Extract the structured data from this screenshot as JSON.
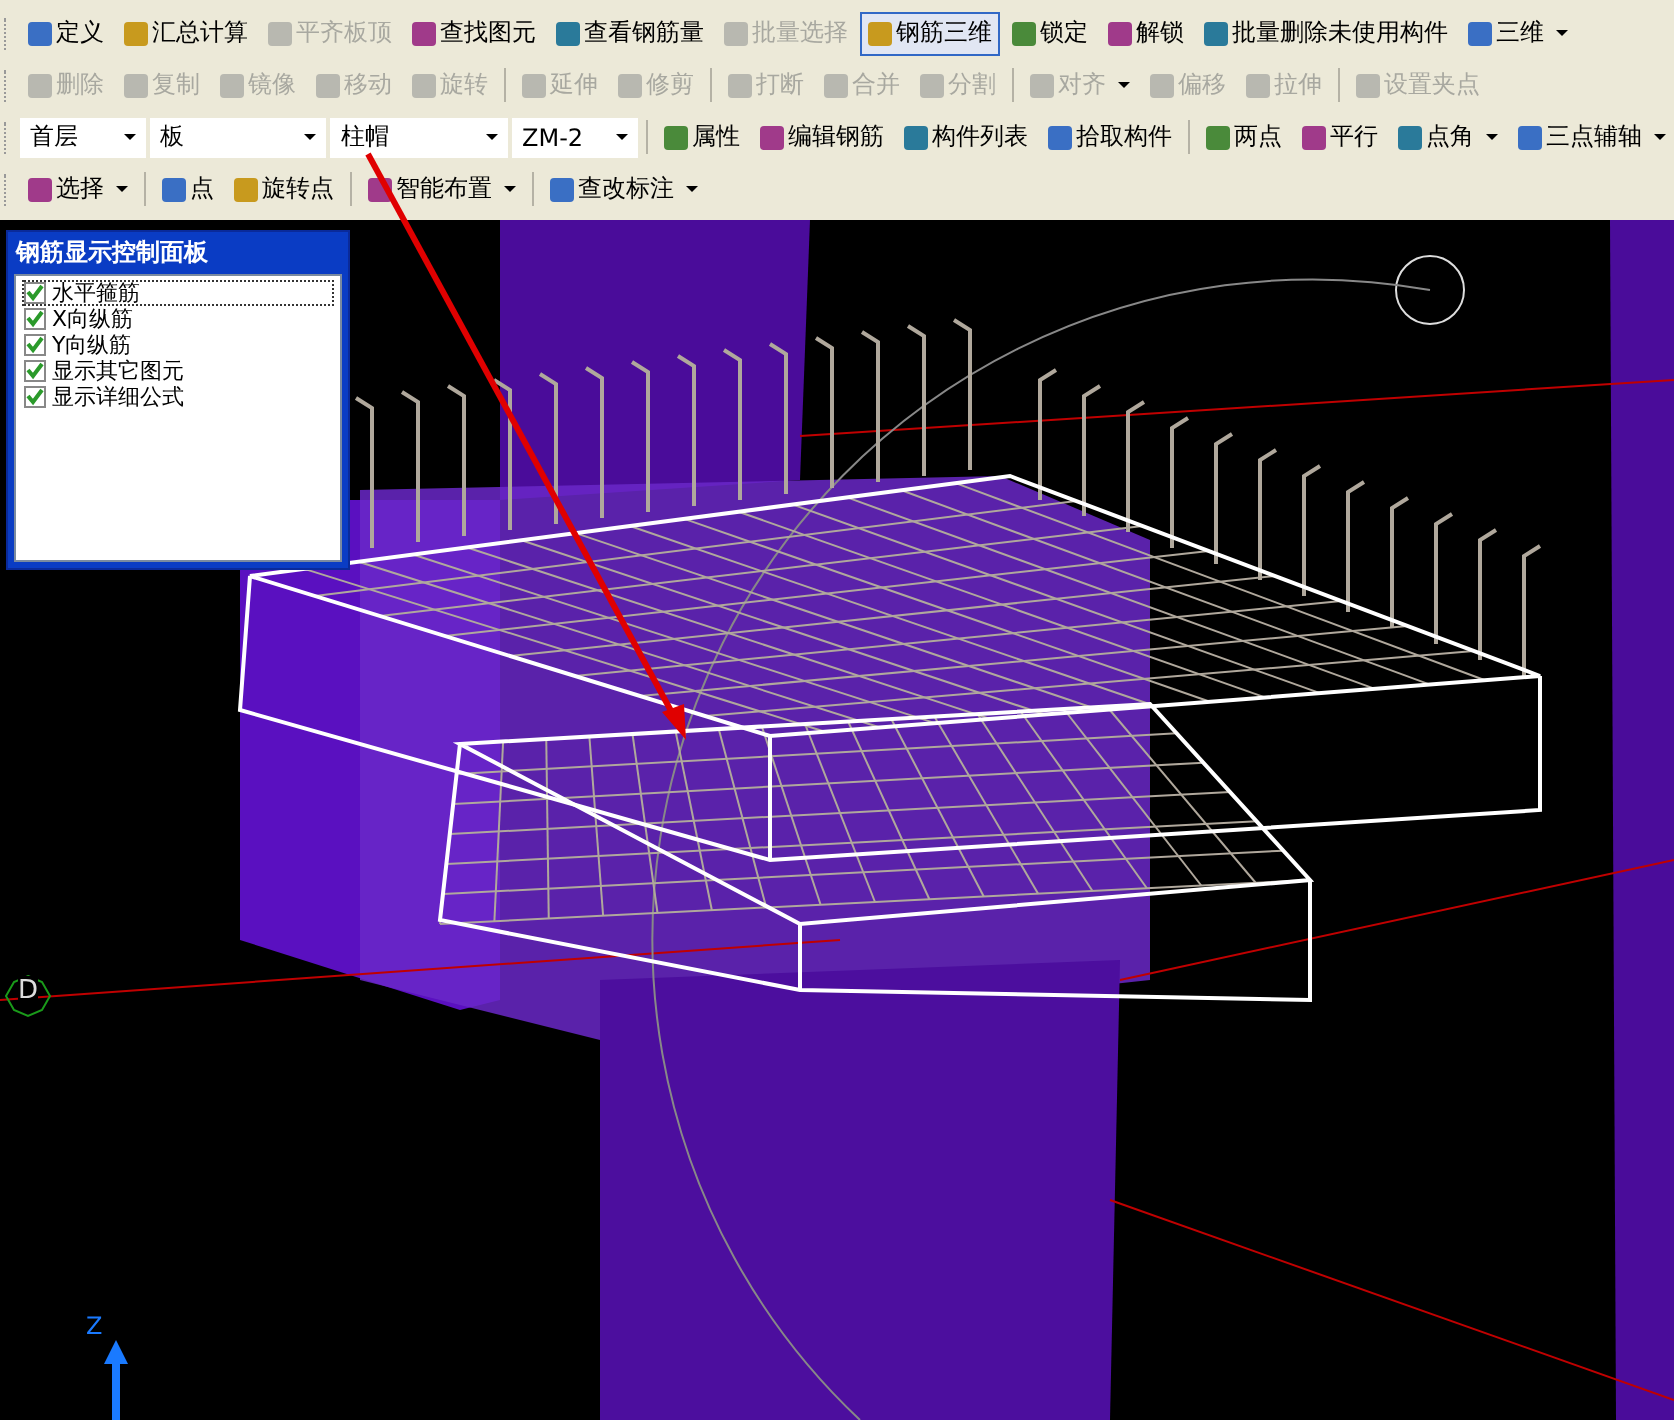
{
  "toolbars": [
    {
      "items": [
        {
          "kind": "button",
          "label": "定义",
          "disabled": false,
          "selected": false
        },
        {
          "kind": "button",
          "label": "汇总计算",
          "disabled": false,
          "selected": false
        },
        {
          "kind": "button",
          "label": "平齐板顶",
          "disabled": true,
          "selected": false
        },
        {
          "kind": "button",
          "label": "查找图元",
          "disabled": false,
          "selected": false
        },
        {
          "kind": "button",
          "label": "查看钢筋量",
          "disabled": false,
          "selected": false
        },
        {
          "kind": "button",
          "label": "批量选择",
          "disabled": true,
          "selected": false
        },
        {
          "kind": "button",
          "label": "钢筋三维",
          "disabled": false,
          "selected": true
        },
        {
          "kind": "button",
          "label": "锁定",
          "disabled": false,
          "selected": false
        },
        {
          "kind": "button",
          "label": "解锁",
          "disabled": false,
          "selected": false
        },
        {
          "kind": "button",
          "label": "批量删除未使用构件",
          "disabled": false,
          "selected": false
        },
        {
          "kind": "menu",
          "label": "三维",
          "disabled": false,
          "selected": false
        }
      ]
    },
    {
      "items": [
        {
          "kind": "button",
          "label": "删除",
          "disabled": true,
          "selected": false
        },
        {
          "kind": "button",
          "label": "复制",
          "disabled": true,
          "selected": false
        },
        {
          "kind": "button",
          "label": "镜像",
          "disabled": true,
          "selected": false
        },
        {
          "kind": "button",
          "label": "移动",
          "disabled": true,
          "selected": false
        },
        {
          "kind": "button",
          "label": "旋转",
          "disabled": true,
          "selected": false
        },
        {
          "kind": "separator"
        },
        {
          "kind": "button",
          "label": "延伸",
          "disabled": true,
          "selected": false
        },
        {
          "kind": "button",
          "label": "修剪",
          "disabled": true,
          "selected": false
        },
        {
          "kind": "separator"
        },
        {
          "kind": "button",
          "label": "打断",
          "disabled": true,
          "selected": false
        },
        {
          "kind": "button",
          "label": "合并",
          "disabled": true,
          "selected": false
        },
        {
          "kind": "button",
          "label": "分割",
          "disabled": true,
          "selected": false
        },
        {
          "kind": "separator"
        },
        {
          "kind": "menu",
          "label": "对齐",
          "disabled": true,
          "selected": false
        },
        {
          "kind": "button",
          "label": "偏移",
          "disabled": true,
          "selected": false
        },
        {
          "kind": "button",
          "label": "拉伸",
          "disabled": true,
          "selected": false
        },
        {
          "kind": "separator"
        },
        {
          "kind": "button",
          "label": "设置夹点",
          "disabled": true,
          "selected": false
        }
      ]
    },
    {
      "items": [
        {
          "kind": "combo",
          "value": "首层"
        },
        {
          "kind": "combo",
          "value": "板"
        },
        {
          "kind": "combo",
          "value": "柱帽"
        },
        {
          "kind": "combo",
          "value": "ZM-2"
        },
        {
          "kind": "separator"
        },
        {
          "kind": "button",
          "label": "属性",
          "disabled": false,
          "selected": false
        },
        {
          "kind": "button",
          "label": "编辑钢筋",
          "disabled": false,
          "selected": false
        },
        {
          "kind": "button",
          "label": "构件列表",
          "disabled": false,
          "selected": false
        },
        {
          "kind": "button",
          "label": "拾取构件",
          "disabled": false,
          "selected": false
        },
        {
          "kind": "separator"
        },
        {
          "kind": "button",
          "label": "两点",
          "disabled": false,
          "selected": false
        },
        {
          "kind": "button",
          "label": "平行",
          "disabled": false,
          "selected": false
        },
        {
          "kind": "menu",
          "label": "点角",
          "disabled": false,
          "selected": false
        },
        {
          "kind": "menu",
          "label": "三点辅轴",
          "disabled": false,
          "selected": false
        }
      ]
    },
    {
      "items": [
        {
          "kind": "menu",
          "label": "选择",
          "disabled": false,
          "selected": false
        },
        {
          "kind": "separator"
        },
        {
          "kind": "button",
          "label": "点",
          "disabled": false,
          "selected": false
        },
        {
          "kind": "button",
          "label": "旋转点",
          "disabled": false,
          "selected": false
        },
        {
          "kind": "separator"
        },
        {
          "kind": "menu",
          "label": "智能布置",
          "disabled": false,
          "selected": false
        },
        {
          "kind": "separator"
        },
        {
          "kind": "menu",
          "label": "查改标注",
          "disabled": false,
          "selected": false
        }
      ]
    }
  ],
  "panel": {
    "title": "钢筋显示控制面板",
    "items": [
      {
        "label": "水平箍筋",
        "checked": true,
        "selected": true
      },
      {
        "label": "X向纵筋",
        "checked": true,
        "selected": false
      },
      {
        "label": "Y向纵筋",
        "checked": true,
        "selected": false
      },
      {
        "label": "显示其它图元",
        "checked": true,
        "selected": false
      },
      {
        "label": "显示详细公式",
        "checked": true,
        "selected": false
      }
    ]
  },
  "viewport": {
    "axis_marker": "D",
    "axis_label": "Z"
  }
}
